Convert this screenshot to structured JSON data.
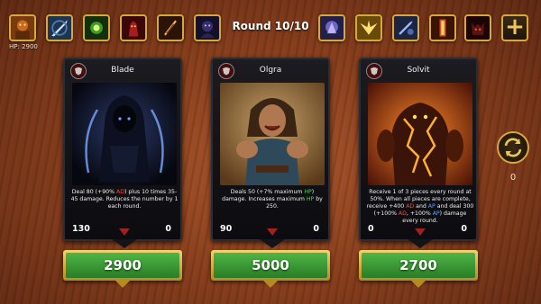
{
  "top_bar": {
    "player_hp": "HP: 2900",
    "round": "Round 10/10",
    "left_items": [
      {
        "icon": "hero-portrait-icon",
        "color": "#c96a1c"
      },
      {
        "icon": "sword-strike-icon",
        "color": "#4e7fb0"
      },
      {
        "icon": "nature-burst-icon",
        "color": "#3f9a2a"
      },
      {
        "icon": "demon-warrior-icon",
        "color": "#a51d1d"
      },
      {
        "icon": "flame-blade-icon",
        "color": "#7a3a12"
      },
      {
        "icon": "shadow-figure-icon",
        "color": "#3a2f6a"
      }
    ],
    "right_items": [
      {
        "icon": "arcane-mage-icon",
        "color": "#6e64c8"
      },
      {
        "icon": "golden-wings-icon",
        "color": "#e6b018"
      },
      {
        "icon": "arcane-blade-icon",
        "color": "#4a6ab0"
      },
      {
        "icon": "fire-pillar-icon",
        "color": "#d2541a"
      },
      {
        "icon": "dark-demon-icon",
        "color": "#5a1414"
      }
    ],
    "add_label": "+"
  },
  "cards": [
    {
      "name": "Blade",
      "art": "hooded-assassin-art",
      "desc_parts": [
        {
          "t": "Deal 80 (+90% ",
          "c": ""
        },
        {
          "t": "AD",
          "c": "ad"
        },
        {
          "t": ") plus 10 times 35-45 damage. Reduces the number by 1 each round.",
          "c": ""
        }
      ],
      "stat_left": "130",
      "stat_right": "0",
      "price": "2900"
    },
    {
      "name": "Olgra",
      "art": "warrior-woman-art",
      "desc_parts": [
        {
          "t": "Deals 50 (+7% maximum ",
          "c": ""
        },
        {
          "t": "HP",
          "c": "hp"
        },
        {
          "t": ") damage. Increases maximum ",
          "c": ""
        },
        {
          "t": "HP",
          "c": "hp"
        },
        {
          "t": " by 250.",
          "c": ""
        }
      ],
      "stat_left": "90",
      "stat_right": "0",
      "price": "5000"
    },
    {
      "name": "Solvit",
      "art": "lava-golem-art",
      "desc_parts": [
        {
          "t": "Receive 1 of 3 pieces every round at 50%. When all pieces are complete, receive +400 ",
          "c": ""
        },
        {
          "t": "AD",
          "c": "ad"
        },
        {
          "t": " and ",
          "c": ""
        },
        {
          "t": "AP",
          "c": "ap"
        },
        {
          "t": " and deal 300 (+100% ",
          "c": ""
        },
        {
          "t": "AD",
          "c": "ad"
        },
        {
          "t": ", +100% ",
          "c": ""
        },
        {
          "t": "AP",
          "c": "ap"
        },
        {
          "t": ") damage every round.",
          "c": ""
        }
      ],
      "stat_left": "0",
      "stat_right": "0",
      "price": "2700"
    }
  ],
  "refresh": {
    "count": "0",
    "icon": "refresh-icon"
  },
  "colors": {
    "ad": "#ff4a3a",
    "hp": "#4fd15a",
    "ap": "#5aa0ff",
    "gold": "#d6a93c",
    "price_green": "#3f9a36"
  }
}
